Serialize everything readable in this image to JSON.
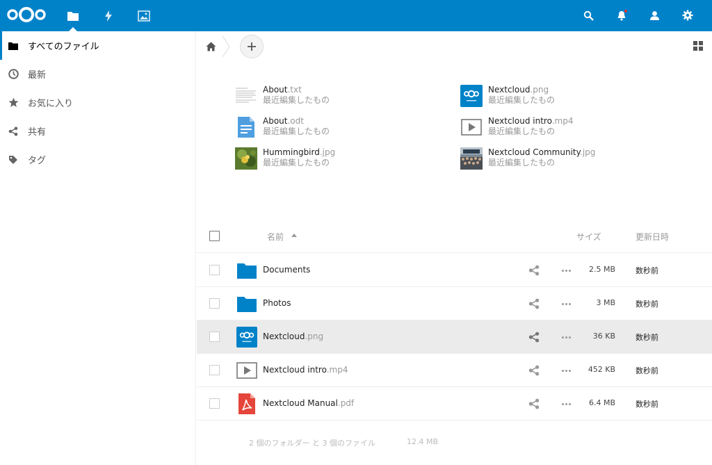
{
  "header": {
    "apps": [
      {
        "name": "files",
        "icon": "folder-icon",
        "active": true
      },
      {
        "name": "activity",
        "icon": "lightning-icon",
        "active": false
      },
      {
        "name": "gallery",
        "icon": "image-icon",
        "active": false
      }
    ],
    "right_icons": [
      "search-icon",
      "notifications-icon",
      "contacts-icon",
      "settings-icon"
    ]
  },
  "sidebar": {
    "items": [
      {
        "label": "すべてのファイル",
        "icon": "folder-icon",
        "active": true
      },
      {
        "label": "最新",
        "icon": "clock-icon",
        "active": false
      },
      {
        "label": "お気に入り",
        "icon": "star-icon",
        "active": false
      },
      {
        "label": "共有",
        "icon": "share-icon",
        "active": false
      },
      {
        "label": "タグ",
        "icon": "tag-icon",
        "active": false
      }
    ]
  },
  "recent": {
    "items": [
      {
        "base": "About",
        "ext": ".txt",
        "sub": "最近編集したもの",
        "thumb": "text-thumb"
      },
      {
        "base": "Nextcloud",
        "ext": ".png",
        "sub": "最近編集したもの",
        "thumb": "nextcloud-thumb"
      },
      {
        "base": "About",
        "ext": ".odt",
        "sub": "最近編集したもの",
        "thumb": "document-thumb"
      },
      {
        "base": "Nextcloud intro",
        "ext": ".mp4",
        "sub": "最近編集したもの",
        "thumb": "video-thumb"
      },
      {
        "base": "Hummingbird",
        "ext": ".jpg",
        "sub": "最近編集したもの",
        "thumb": "photo-thumb"
      },
      {
        "base": "Nextcloud Community",
        "ext": ".jpg",
        "sub": "最近編集したもの",
        "thumb": "community-thumb"
      }
    ]
  },
  "table": {
    "headers": {
      "name": "名前",
      "size": "サイズ",
      "modified": "更新日時"
    },
    "rows": [
      {
        "base": "Documents",
        "ext": "",
        "size": "2.5 MB",
        "modified": "数秒前",
        "icon": "folder-icon",
        "selected": false
      },
      {
        "base": "Photos",
        "ext": "",
        "size": "3 MB",
        "modified": "数秒前",
        "icon": "folder-icon",
        "selected": false
      },
      {
        "base": "Nextcloud",
        "ext": ".png",
        "size": "36 KB",
        "modified": "数秒前",
        "icon": "nextcloud-thumb",
        "selected": true
      },
      {
        "base": "Nextcloud intro",
        "ext": ".mp4",
        "size": "452 KB",
        "modified": "数秒前",
        "icon": "video-icon",
        "selected": false
      },
      {
        "base": "Nextcloud Manual",
        "ext": ".pdf",
        "size": "6.4 MB",
        "modified": "数秒前",
        "icon": "pdf-icon",
        "selected": false
      }
    ],
    "summary": "2 個のフォルダー と 3 個のファイル",
    "summary_size": "12.4 MB"
  },
  "colors": {
    "brand": "#0082c9",
    "selected_row": "#ebebeb",
    "pdf": "#e5453a"
  }
}
